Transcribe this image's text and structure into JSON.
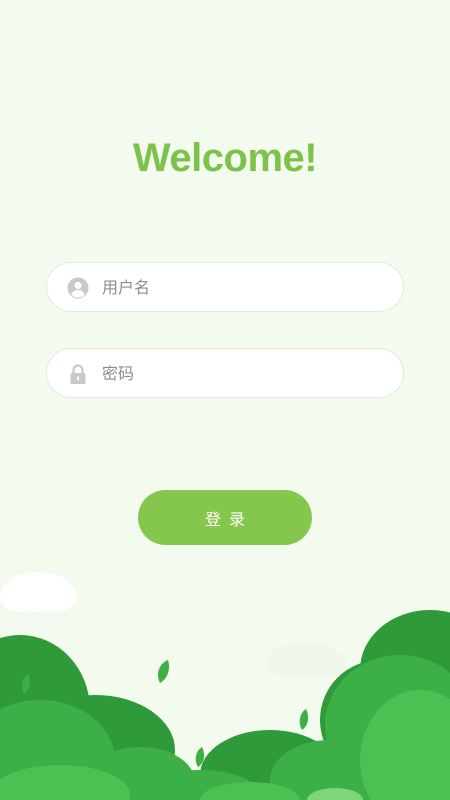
{
  "header": {
    "title": "Welcome!"
  },
  "form": {
    "username": {
      "placeholder": "用户名",
      "value": "",
      "icon": "user-circle-icon"
    },
    "password": {
      "placeholder": "密码",
      "value": "",
      "icon": "lock-icon"
    },
    "login_label": "登录"
  },
  "colors": {
    "background": "#f3fbee",
    "accent": "#7dc24b",
    "button": "#85c64d",
    "tree_dark": "#2e9a3a",
    "tree_mid": "#3cb046",
    "tree_light": "#4dc053"
  }
}
